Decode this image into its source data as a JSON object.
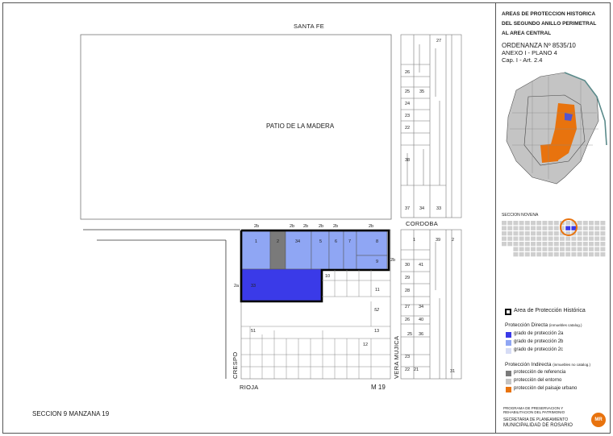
{
  "streets": {
    "santa_fe": "SANTA FE",
    "cordoba": "CORDOBA",
    "rioja": "RIOJA",
    "crespo": "CRESPO",
    "vera_mujica": "VERA MUJICA"
  },
  "areas": {
    "patio": "PATIO DE LA MADERA",
    "manzana_code": "M 19"
  },
  "footer_left": "SECCION 9  MANZANA 19",
  "grade_labels": {
    "g1": "2b",
    "g2": "2b",
    "g3": "2b",
    "g4": "2b",
    "g5": "2b",
    "g6": "2b",
    "side_right": "2b",
    "side_left": "2a"
  },
  "lot_numbers": {
    "l1": "1",
    "l2": "2",
    "l34": "34",
    "l5": "5",
    "l6": "6",
    "l7": "7",
    "l8": "8",
    "l9": "9",
    "l33": "33",
    "l10": "10",
    "l11": "11",
    "l12": "12",
    "l13": "13",
    "l51": "51",
    "l52": "52"
  },
  "east_block_numbers": {
    "n27": "27",
    "n26": "26",
    "n25": "25",
    "n35": "35",
    "n24": "24",
    "n23": "23",
    "n22": "22",
    "n38": "38",
    "n37": "37",
    "n34": "34",
    "n33": "33",
    "s1": "1",
    "s39": "39",
    "s2": "2",
    "s30": "30",
    "s41": "41",
    "s29": "29",
    "s28": "28",
    "s27": "27",
    "s34": "34",
    "s26": "26",
    "s40": "40",
    "s25": "25",
    "s36": "36",
    "s23": "23",
    "s22": "22",
    "s21": "21",
    "s31": "31"
  },
  "title_block": {
    "line1": "AREAS DE PROTECCION HISTORICA",
    "line2": "DEL SEGUNDO ANILLO PERIMETRAL",
    "line3": "AL AREA CENTRAL",
    "ordinance": "ORDENANZA Nº 8535/10",
    "annex": "ANEXO I - PLANO 4",
    "chapter": "Cap. I - Art. 2.4"
  },
  "section_label": "SECCION NOVENA",
  "legend": {
    "area_label": "Area de Protección Histórica",
    "direct_title": "Protección Directa",
    "direct_sub": "(inmuebles catalog.)",
    "grade_2a": "grado de protección 2a",
    "grade_2b": "grado de protección 2b",
    "grade_2c": "grado de protección 2c",
    "indirect_title": "Protección Indirecta",
    "indirect_sub": "(inmuebles no catalog.)",
    "ref": "protección de referencia",
    "entorno": "protección del entorno",
    "paisaje": "protección del paisaje urbano"
  },
  "credits": {
    "program_line1": "PROGRAMA  DE  PRESERVACION  Y",
    "program_line2": "REHABILITACION  DEL  PATRIMONIO",
    "secretaria": "SECRETARIA DE PLANEAMIENTO",
    "municipalidad": "MUNICIPALIDAD DE ROSARIO",
    "logo_text": "MR"
  },
  "colors": {
    "grade_2a": "#3a3ae8",
    "grade_2b": "#8fa6f4",
    "grade_2c": "#d6dcf5",
    "referencia": "#7a7a7a",
    "entorno": "#c4c4c4",
    "paisaje": "#e8730e",
    "highlight_ring": "#e8730e"
  }
}
